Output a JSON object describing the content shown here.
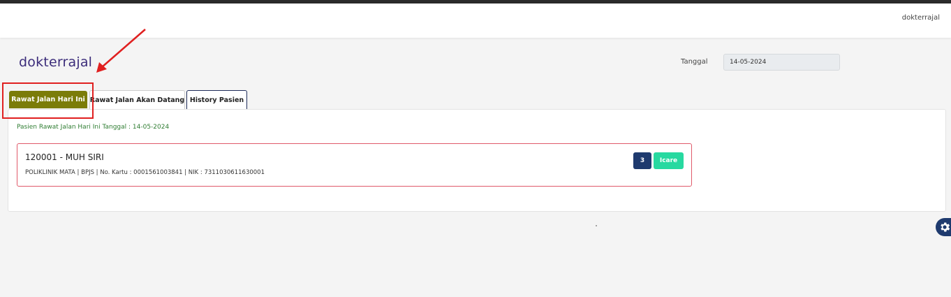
{
  "navbar": {
    "username": "dokterrajal"
  },
  "page": {
    "title": "dokterrajal"
  },
  "date_filter": {
    "label": "Tanggal",
    "value": "14-05-2024"
  },
  "tabs": [
    {
      "label": "Rawat Jalan Hari Ini",
      "active": true
    },
    {
      "label": "Rawat Jalan Akan Datang",
      "active": false
    },
    {
      "label": "History Pasien",
      "active": false
    }
  ],
  "panel": {
    "heading": "Pasien Rawat Jalan Hari Ini Tanggal : 14-05-2024",
    "patients": [
      {
        "name": "120001 - MUH SIRI",
        "info": "POLIKLINIK MATA | BPJS | No. Kartu : 0001561003841 | NIK : 7311030611630001",
        "queue_number": "3",
        "tag": "Icare"
      }
    ]
  },
  "colors": {
    "active_tab": "#7b7c09",
    "title": "#3b2c7a",
    "heading": "#2f7d32",
    "card_border": "#e05a6a",
    "badge_number": "#1e3a6e",
    "badge_icare": "#27d9a0",
    "annotation": "#e02020"
  },
  "icons": {
    "settings": "gear-icon"
  }
}
